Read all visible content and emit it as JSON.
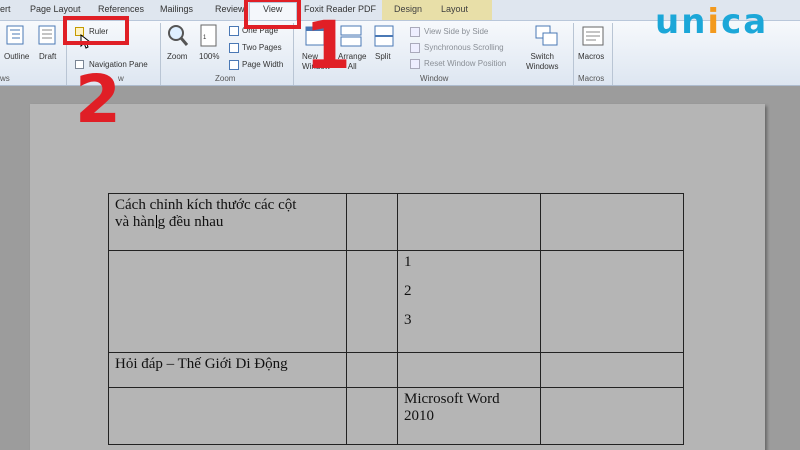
{
  "tabs": [
    "ert",
    "Page Layout",
    "References",
    "Mailings",
    "Review",
    "View",
    "Foxit Reader PDF",
    "Design",
    "Layout"
  ],
  "ribbon": {
    "views_group": {
      "outline": "Outline",
      "draft": "Draft",
      "label": "ws"
    },
    "show_group": {
      "ruler": "Ruler",
      "navigation_pane": "Navigation Pane",
      "label": "w"
    },
    "zoom_group": {
      "zoom": "Zoom",
      "hundred": "100%",
      "one_page": "One Page",
      "two_pages": "Two Pages",
      "page_width": "Page Width",
      "label": "Zoom"
    },
    "window_group": {
      "new_window": "New\nWindow",
      "arrange_all": "Arrange\nAll",
      "split": "Split",
      "view_side_by_side": "View Side by Side",
      "synchronous_scrolling": "Synchronous Scrolling",
      "reset_window_position": "Reset Window Position",
      "switch_windows": "Switch\nWindows",
      "label": "Window"
    },
    "macros_group": {
      "macros": "Macros",
      "label": "Macros"
    }
  },
  "annotations": {
    "step1": "1",
    "step2": "2"
  },
  "logo": {
    "text_a": "un",
    "text_b": "i",
    "text_c": "ca"
  },
  "table": {
    "r1c1_line1": "Cách chỉnh kích thước các cột",
    "r1c1_line2a": "và hàn",
    "r1c1_line2b": "g đều nhau",
    "r2c3": [
      "1",
      "2",
      "3"
    ],
    "r3c1": "Hỏi đáp – Thế Giới Di Động",
    "r4c3_line1": "Microsoft Word",
    "r4c3_line2": "2010"
  },
  "colors": {
    "annotation_red": "#e01f26",
    "logo_blue": "#1ca7d8",
    "logo_orange": "#f39a1e"
  }
}
